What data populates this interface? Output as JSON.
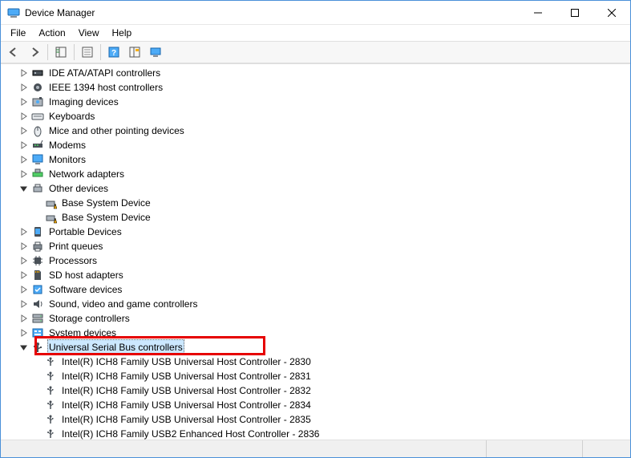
{
  "window": {
    "title": "Device Manager"
  },
  "menu": {
    "file": "File",
    "action": "Action",
    "view": "View",
    "help": "Help"
  },
  "tree": {
    "items": [
      {
        "expander": "collapsed",
        "indent": 1,
        "icon": "ide",
        "label": "IDE ATA/ATAPI controllers",
        "selected": false
      },
      {
        "expander": "collapsed",
        "indent": 1,
        "icon": "ieee1394",
        "label": "IEEE 1394 host controllers",
        "selected": false
      },
      {
        "expander": "collapsed",
        "indent": 1,
        "icon": "imaging",
        "label": "Imaging devices",
        "selected": false
      },
      {
        "expander": "collapsed",
        "indent": 1,
        "icon": "keyboard",
        "label": "Keyboards",
        "selected": false
      },
      {
        "expander": "collapsed",
        "indent": 1,
        "icon": "mouse",
        "label": "Mice and other pointing devices",
        "selected": false
      },
      {
        "expander": "collapsed",
        "indent": 1,
        "icon": "modem",
        "label": "Modems",
        "selected": false
      },
      {
        "expander": "collapsed",
        "indent": 1,
        "icon": "monitor",
        "label": "Monitors",
        "selected": false
      },
      {
        "expander": "collapsed",
        "indent": 1,
        "icon": "network",
        "label": "Network adapters",
        "selected": false
      },
      {
        "expander": "expanded",
        "indent": 1,
        "icon": "other",
        "label": "Other devices",
        "selected": false
      },
      {
        "expander": "none",
        "indent": 2,
        "icon": "warning",
        "label": "Base System Device",
        "selected": false
      },
      {
        "expander": "none",
        "indent": 2,
        "icon": "warning",
        "label": "Base System Device",
        "selected": false
      },
      {
        "expander": "collapsed",
        "indent": 1,
        "icon": "portable",
        "label": "Portable Devices",
        "selected": false
      },
      {
        "expander": "collapsed",
        "indent": 1,
        "icon": "printer",
        "label": "Print queues",
        "selected": false
      },
      {
        "expander": "collapsed",
        "indent": 1,
        "icon": "processor",
        "label": "Processors",
        "selected": false
      },
      {
        "expander": "collapsed",
        "indent": 1,
        "icon": "sd",
        "label": "SD host adapters",
        "selected": false
      },
      {
        "expander": "collapsed",
        "indent": 1,
        "icon": "software",
        "label": "Software devices",
        "selected": false
      },
      {
        "expander": "collapsed",
        "indent": 1,
        "icon": "sound",
        "label": "Sound, video and game controllers",
        "selected": false
      },
      {
        "expander": "collapsed",
        "indent": 1,
        "icon": "storage",
        "label": "Storage controllers",
        "selected": false
      },
      {
        "expander": "collapsed",
        "indent": 1,
        "icon": "system",
        "label": "System devices",
        "selected": false
      },
      {
        "expander": "expanded",
        "indent": 1,
        "icon": "usb",
        "label": "Universal Serial Bus controllers",
        "selected": true,
        "highlighted": true
      },
      {
        "expander": "none",
        "indent": 2,
        "icon": "usbdev",
        "label": "Intel(R) ICH8 Family USB Universal Host Controller - 2830",
        "selected": false
      },
      {
        "expander": "none",
        "indent": 2,
        "icon": "usbdev",
        "label": "Intel(R) ICH8 Family USB Universal Host Controller - 2831",
        "selected": false
      },
      {
        "expander": "none",
        "indent": 2,
        "icon": "usbdev",
        "label": "Intel(R) ICH8 Family USB Universal Host Controller - 2832",
        "selected": false
      },
      {
        "expander": "none",
        "indent": 2,
        "icon": "usbdev",
        "label": "Intel(R) ICH8 Family USB Universal Host Controller - 2834",
        "selected": false
      },
      {
        "expander": "none",
        "indent": 2,
        "icon": "usbdev",
        "label": "Intel(R) ICH8 Family USB Universal Host Controller - 2835",
        "selected": false
      },
      {
        "expander": "none",
        "indent": 2,
        "icon": "usbdev",
        "label": "Intel(R) ICH8 Family USB2 Enhanced Host Controller - 2836",
        "selected": false
      }
    ]
  }
}
